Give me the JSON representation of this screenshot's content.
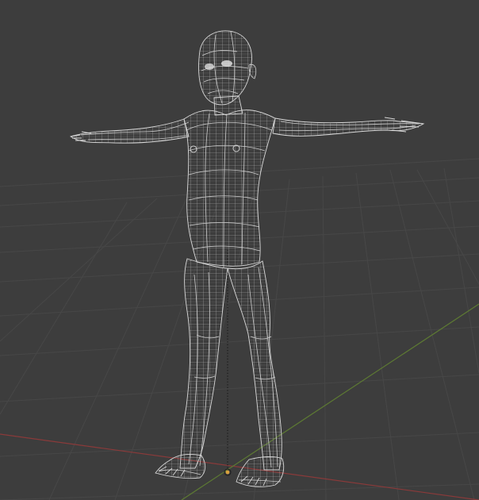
{
  "viewport": {
    "view_type": "3d-viewport",
    "shading_mode": "wireframe",
    "object": "humanoid-mesh-t-pose",
    "colors": {
      "background": "#3d3d3d",
      "grid_line": "#484848",
      "x_axis": "#8a3a3a",
      "y_axis": "#5d7a33",
      "wire": "#cfcfcf",
      "wire_dark": "#8d8d8d",
      "eye": "#e7e7e7",
      "origin": "#d8a13d"
    },
    "icons": [
      "origin-marker-icon"
    ]
  }
}
